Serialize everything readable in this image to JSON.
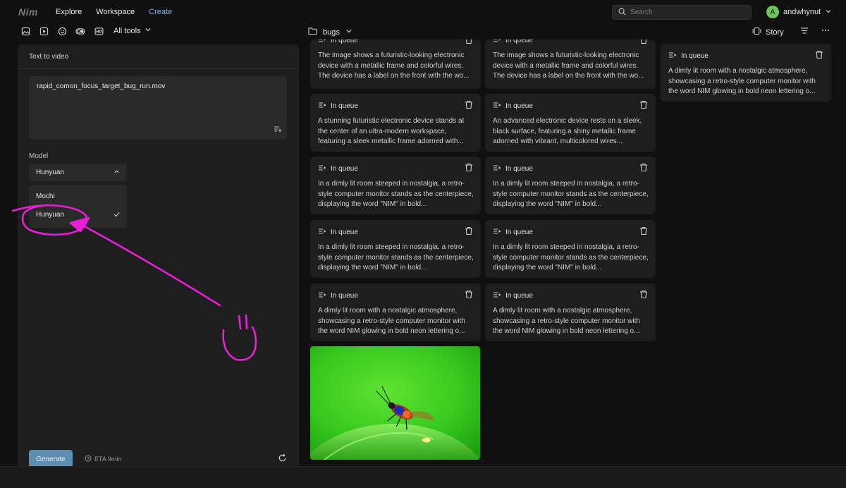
{
  "app": {
    "logo": "Nim"
  },
  "nav": {
    "items": [
      "Explore",
      "Workspace",
      "Create"
    ],
    "active": "Create"
  },
  "search": {
    "placeholder": "Search"
  },
  "user": {
    "initial": "A",
    "name": "andwhynut"
  },
  "toolbar": {
    "all_tools": "All tools",
    "folder": "bugs",
    "story": "Story"
  },
  "panel": {
    "title": "Text to video",
    "prompt": "rapid_comon_focus_target_bug_run.mov",
    "model_label": "Model",
    "model_selected": "Hunyuan",
    "model_options": [
      "Mochi",
      "Hunyuan"
    ],
    "generate": "Generate",
    "eta": "ETA 9min"
  },
  "queue_label": "In queue",
  "cards": [
    {
      "text": "The image shows a futuristic-looking electronic device with a metallic frame and colorful wires. The device has a label on the front with the wo..."
    },
    {
      "text": "The image shows a futuristic-looking electronic device with a metallic frame and colorful wires. The device has a label on the front with the wo..."
    },
    {
      "text": "A dimly lit room with a nostalgic atmosphere, showcasing a retro-style computer monitor with the word NIM glowing in bold neon lettering o..."
    },
    {
      "text": "A stunning futuristic electronic device stands at the center of an ultra-modern workspace, featuring a sleek metallic frame adorned with..."
    },
    {
      "text": "An advanced electronic device rests on a sleek, black surface, featuring a shiny metallic frame adorned with vibrant, multicolored wires..."
    },
    {
      "text": "In a dimly lit room steeped in nostalgia, a retro-style computer monitor stands as the centerpiece, displaying the word \"NIM\" in bold..."
    },
    {
      "text": "In a dimly lit room steeped in nostalgia, a retro-style computer monitor stands as the centerpiece, displaying the word \"NIM\" in bold..."
    },
    {
      "text": "In a dimly lit room steeped in nostalgia, a retro-style computer monitor stands as the centerpiece, displaying the word \"NIM\" in bold..."
    },
    {
      "text": "In a dimly lit room steeped in nostalgia, a retro-style computer monitor stands as the centerpiece, displaying the word \"NIM\" in bold..."
    },
    {
      "text": "A dimly lit room with a nostalgic atmosphere, showcasing a retro-style computer monitor with the word NIM glowing in bold neon lettering o..."
    },
    {
      "text": "A dimly lit room with a nostalgic atmosphere, showcasing a retro-style computer monitor with the word NIM glowing in bold neon lettering o..."
    }
  ],
  "colors": {
    "accent": "#7fb2e5",
    "generate": "#5d8db0",
    "annotation": "#e81fd6",
    "avatar": "#6fc35b"
  }
}
